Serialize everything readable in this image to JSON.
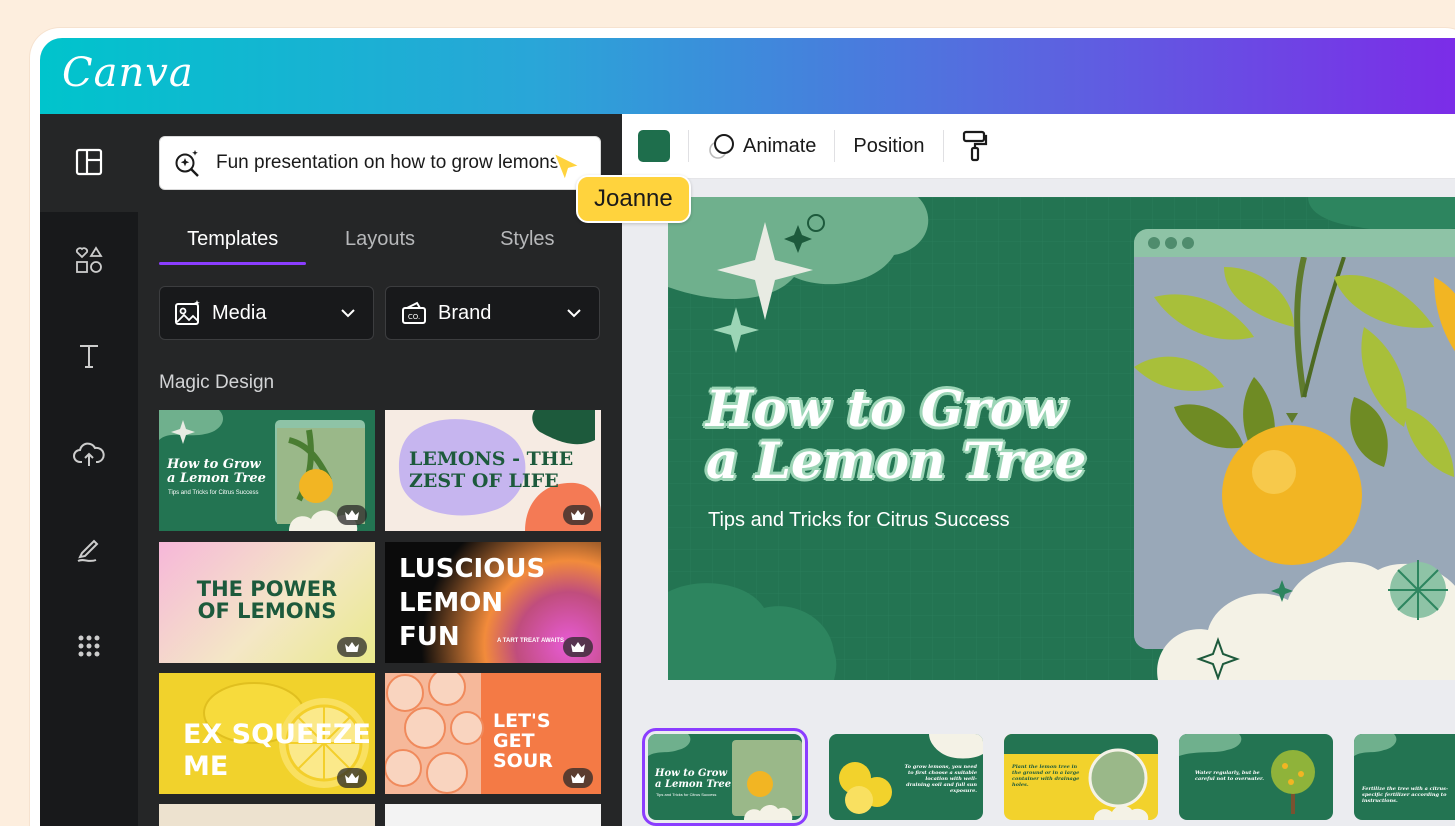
{
  "app": {
    "logo": "Canva"
  },
  "rail": {
    "items": [
      {
        "name": "design",
        "icon": "layout-icon"
      },
      {
        "name": "elements",
        "icon": "shapes-icon"
      },
      {
        "name": "text",
        "icon": "text-icon"
      },
      {
        "name": "uploads",
        "icon": "cloud-upload-icon"
      },
      {
        "name": "draw",
        "icon": "draw-icon"
      },
      {
        "name": "apps",
        "icon": "apps-grid-icon"
      }
    ]
  },
  "panel": {
    "search": {
      "value": "Fun presentation on how to grow lemons"
    },
    "collaborator": {
      "name": "Joanne",
      "color": "#ffd33d"
    },
    "tabs": [
      {
        "label": "Templates",
        "active": true
      },
      {
        "label": "Layouts",
        "active": false
      },
      {
        "label": "Styles",
        "active": false
      }
    ],
    "filters": [
      {
        "label": "Media",
        "icon": "media-icon"
      },
      {
        "label": "Brand",
        "icon": "brand-kit-icon"
      }
    ],
    "section_title": "Magic Design",
    "templates": [
      {
        "title_line1": "How to Grow",
        "title_line2": "a Lemon Tree",
        "subtitle": "Tips and Tricks for Citrus Success"
      },
      {
        "title_line1": "LEMONS - THE",
        "title_line2": "ZEST OF LIFE"
      },
      {
        "title_line1": "THE POWER",
        "title_line2": "OF LEMONS"
      },
      {
        "title_line1": "LUSCIOUS",
        "title_line2": "LEMON",
        "title_line3": "FUN",
        "tagline": "A TART TREAT AWAITS"
      },
      {
        "title_line1": "EX SQUEEZE",
        "title_line2": "ME"
      },
      {
        "title_line1": "LET'S",
        "title_line2": "GET",
        "title_line3": "SOUR"
      }
    ]
  },
  "toolbar": {
    "color": "#1e6e4c",
    "animate_label": "Animate",
    "position_label": "Position"
  },
  "slide": {
    "title_line1": "How to Grow",
    "title_line2": "a Lemon Tree",
    "subtitle": "Tips and Tricks for Citrus Success"
  },
  "filmstrip": {
    "pages": [
      {
        "title_line1": "How to Grow",
        "title_line2": "a Lemon Tree",
        "subtitle": "Tips and Tricks for Citrus Success",
        "active": true
      },
      {
        "text": "To grow lemons, you need to first choose a suitable location with well-draining soil and full sun exposure."
      },
      {
        "text": "Plant the lemon tree in the ground or in a large container with drainage holes."
      },
      {
        "text": "Water regularly, but be careful not to overwater."
      },
      {
        "text": "Fertilize the tree with a citrus-specific fertilizer according to instructions."
      }
    ]
  }
}
